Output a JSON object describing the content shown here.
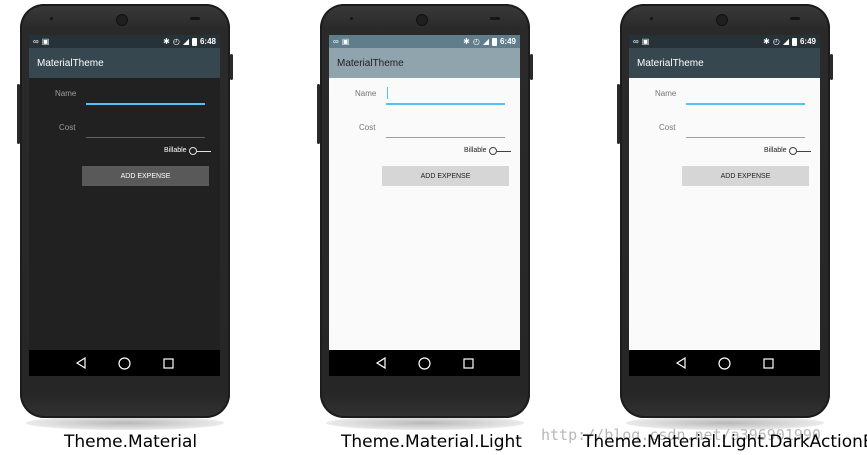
{
  "devices": [
    {
      "theme": "dark",
      "caption": "Theme.Material",
      "status_time": "6:48",
      "app_title": "MaterialTheme",
      "name_label": "Name",
      "cost_label": "Cost",
      "toggle_label": "Billable",
      "button_label": "ADD EXPENSE",
      "colors": {
        "screen": "#212121",
        "action_bar": "#37474f",
        "title": "#ffffff",
        "label": "#9e9e9e",
        "line_active": "#4fc3f7",
        "line": "#616161",
        "button_bg": "#595959",
        "button_text": "#ffffff"
      }
    },
    {
      "theme": "light",
      "caption": "Theme.Material.Light",
      "status_time": "6:49",
      "app_title": "MaterialTheme",
      "name_label": "Name",
      "cost_label": "Cost",
      "toggle_label": "Billable",
      "button_label": "ADD EXPENSE",
      "colors": {
        "screen": "#fafafa",
        "action_bar": "#90a4ae",
        "title": "#212121",
        "label": "#757575",
        "line_active": "#4fc3f7",
        "line": "#9e9e9e",
        "button_bg": "#d6d6d6",
        "button_text": "#212121"
      }
    },
    {
      "theme": "light-dark-actionbar",
      "caption": "Theme.Material.Light.DarkActionBar",
      "status_time": "6:49",
      "app_title": "MaterialTheme",
      "name_label": "Name",
      "cost_label": "Cost",
      "toggle_label": "Billable",
      "button_label": "ADD EXPENSE",
      "colors": {
        "screen": "#fafafa",
        "action_bar": "#37474f",
        "title": "#ffffff",
        "label": "#757575",
        "line_active": "#4fc3f7",
        "line": "#9e9e9e",
        "button_bg": "#d6d6d6",
        "button_text": "#212121"
      }
    }
  ],
  "watermark": "http://blog.csdn.net/a396901990",
  "status_icons": [
    "voicemail-icon",
    "notification-icon",
    "bluetooth-icon",
    "alarm-icon",
    "signal-icon",
    "battery-icon"
  ]
}
